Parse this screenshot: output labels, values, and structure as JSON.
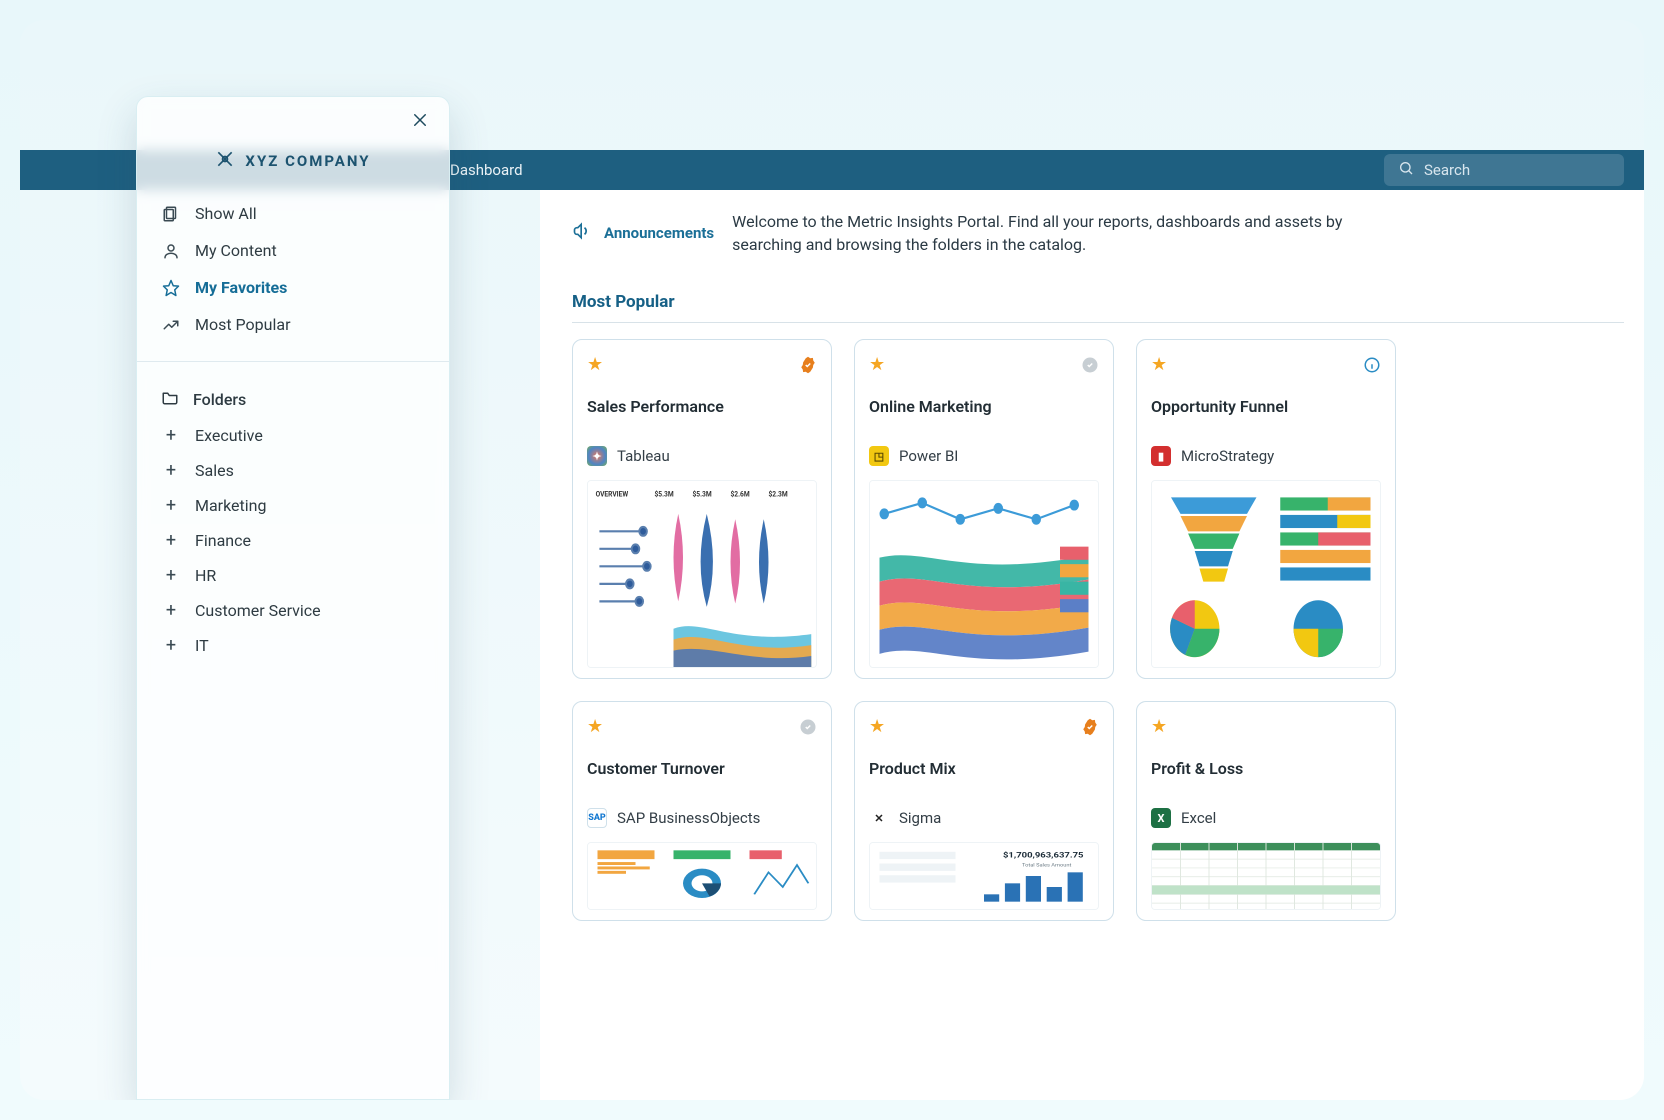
{
  "topbar": {
    "title": "Dashboard",
    "search_placeholder": "Search"
  },
  "announcements": {
    "label": "Announcements",
    "text": "Welcome to the Metric Insights Portal. Find all your reports, dashboards and assets by searching and browsing the folders in the catalog."
  },
  "section": {
    "most_popular": "Most Popular"
  },
  "sidebar": {
    "brand": "XYZ COMPANY",
    "nav": {
      "show_all": "Show All",
      "my_content": "My Content",
      "my_favorites": "My Favorites",
      "most_popular": "Most Popular"
    },
    "folders_label": "Folders",
    "folders": {
      "executive": "Executive",
      "sales": "Sales",
      "marketing": "Marketing",
      "finance": "Finance",
      "hr": "HR",
      "customer_service": "Customer Service",
      "it": "IT"
    }
  },
  "cards": {
    "c0": {
      "title": "Sales Performance",
      "source": "Tableau",
      "badge": "verified"
    },
    "c1": {
      "title": "Online Marketing",
      "source": "Power BI",
      "badge": "pending"
    },
    "c2": {
      "title": "Opportunity Funnel",
      "source": "MicroStrategy",
      "badge": "info"
    },
    "c3": {
      "title": "Customer Turnover",
      "source": "SAP BusinessObjects",
      "badge": "pending"
    },
    "c4": {
      "title": "Product Mix",
      "source": "Sigma",
      "badge": "verified"
    },
    "c5": {
      "title": "Profit & Loss",
      "source": "Excel",
      "badge": "none"
    }
  }
}
